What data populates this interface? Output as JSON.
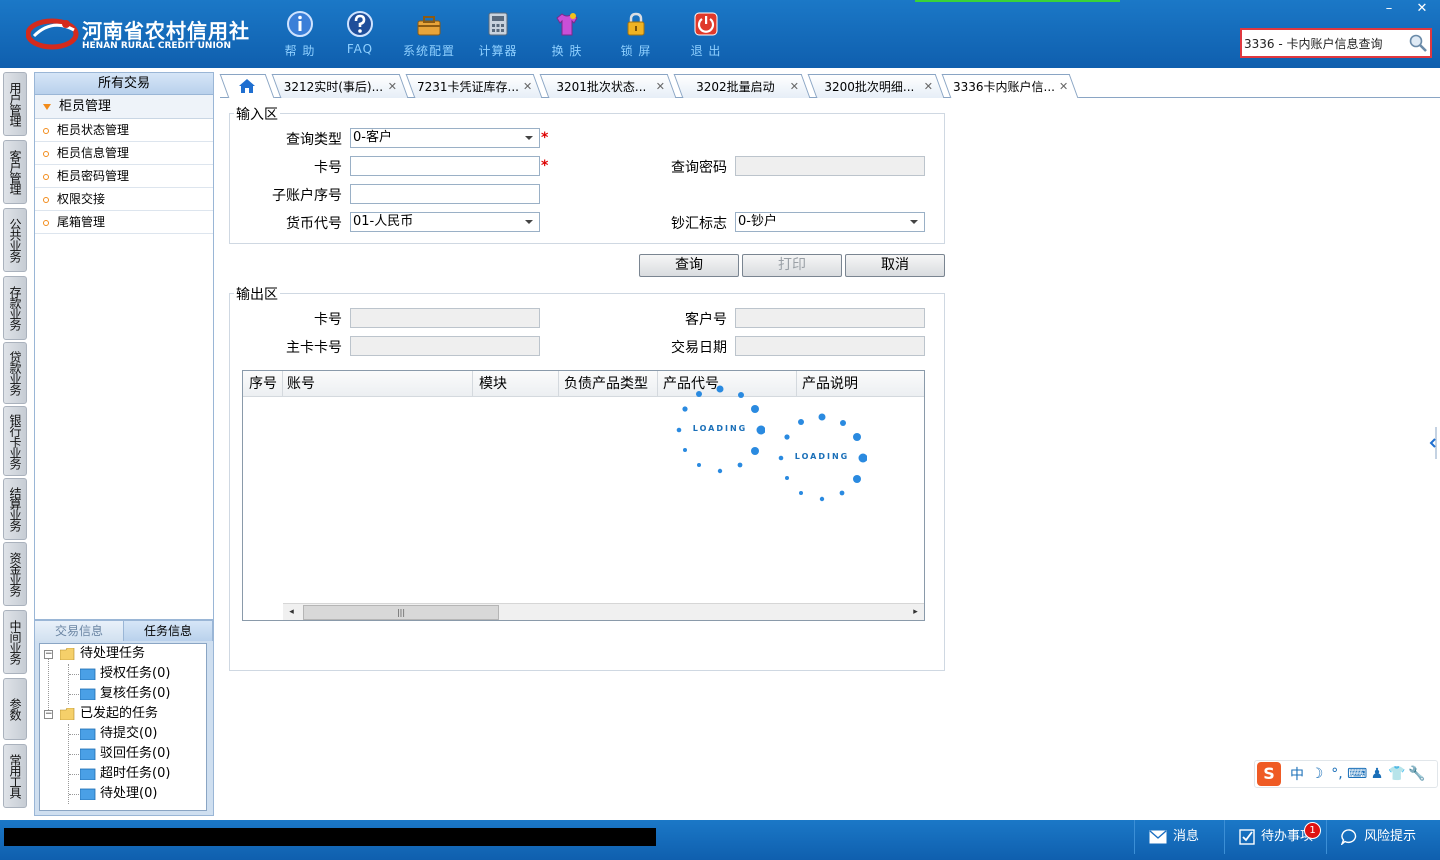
{
  "header": {
    "logo_cn": "河南省农村信用社",
    "logo_en": "HENAN RURAL CREDIT UNION",
    "tools": [
      {
        "label": "帮 助",
        "icon": "info-icon"
      },
      {
        "label": "FAQ",
        "icon": "question-icon"
      },
      {
        "label": "系统配置",
        "icon": "toolbox-icon"
      },
      {
        "label": "计算器",
        "icon": "calculator-icon"
      },
      {
        "label": "换 肤",
        "icon": "shirt-icon"
      },
      {
        "label": "锁 屏",
        "icon": "lock-icon"
      },
      {
        "label": "退 出",
        "icon": "power-icon"
      }
    ],
    "search_value": "3336 - 卡内账户信息查询"
  },
  "vertical_tabs": [
    "用户管理",
    "客户管理",
    "公共业务",
    "存款业务",
    "贷款业务",
    "银行卡业务",
    "结算业务",
    "资金业务",
    "中间业务",
    "参数",
    "常用工具"
  ],
  "left_panel": {
    "title": "所有交易",
    "group": "柜员管理",
    "items": [
      "柜员状态管理",
      "柜员信息管理",
      "柜员密码管理",
      "权限交接",
      "尾箱管理"
    ]
  },
  "task_panel": {
    "tabs": [
      "交易信息",
      "任务信息"
    ],
    "nodes": [
      {
        "label": "待处理任务",
        "level": 0
      },
      {
        "label": "授权任务(0)",
        "level": 1
      },
      {
        "label": "复核任务(0)",
        "level": 1
      },
      {
        "label": "已发起的任务",
        "level": 0
      },
      {
        "label": "待提交(0)",
        "level": 1
      },
      {
        "label": "驳回任务(0)",
        "level": 1
      },
      {
        "label": "超时任务(0)",
        "level": 1
      },
      {
        "label": "待处理(0)",
        "level": 1
      }
    ]
  },
  "tabs": [
    "3212实时(事后)...",
    "7231卡凭证库存...",
    "3201批次状态...",
    "3202批量启动",
    "3200批次明细...",
    "3336卡内账户信..."
  ],
  "input_area": {
    "legend": "输入区",
    "query_type_label": "查询类型",
    "query_type_value": "0-客户",
    "card_no_label": "卡号",
    "card_no_value": "",
    "query_pwd_label": "查询密码",
    "sub_account_label": "子账户序号",
    "currency_label": "货币代号",
    "currency_value": "01-人民币",
    "cash_flag_label": "钞汇标志",
    "cash_flag_value": "0-钞户",
    "required_mark": "*"
  },
  "buttons": {
    "query": "查询",
    "print": "打印",
    "cancel": "取消"
  },
  "output_area": {
    "legend": "输出区",
    "card_no_label": "卡号",
    "customer_no_label": "客户号",
    "main_card_label": "主卡卡号",
    "trade_date_label": "交易日期",
    "columns": [
      "序号",
      "账号",
      "模块",
      "负债产品类型",
      "产品代号",
      "产品说明"
    ]
  },
  "loading_text": "LOADING",
  "ime_chars": [
    "中",
    "☽",
    "°,",
    "⌨",
    "♟",
    "👕",
    "🔧"
  ],
  "statusbar": {
    "message": "消息",
    "todo": "待办事项",
    "risk": "风险提示",
    "todo_badge": "1"
  }
}
